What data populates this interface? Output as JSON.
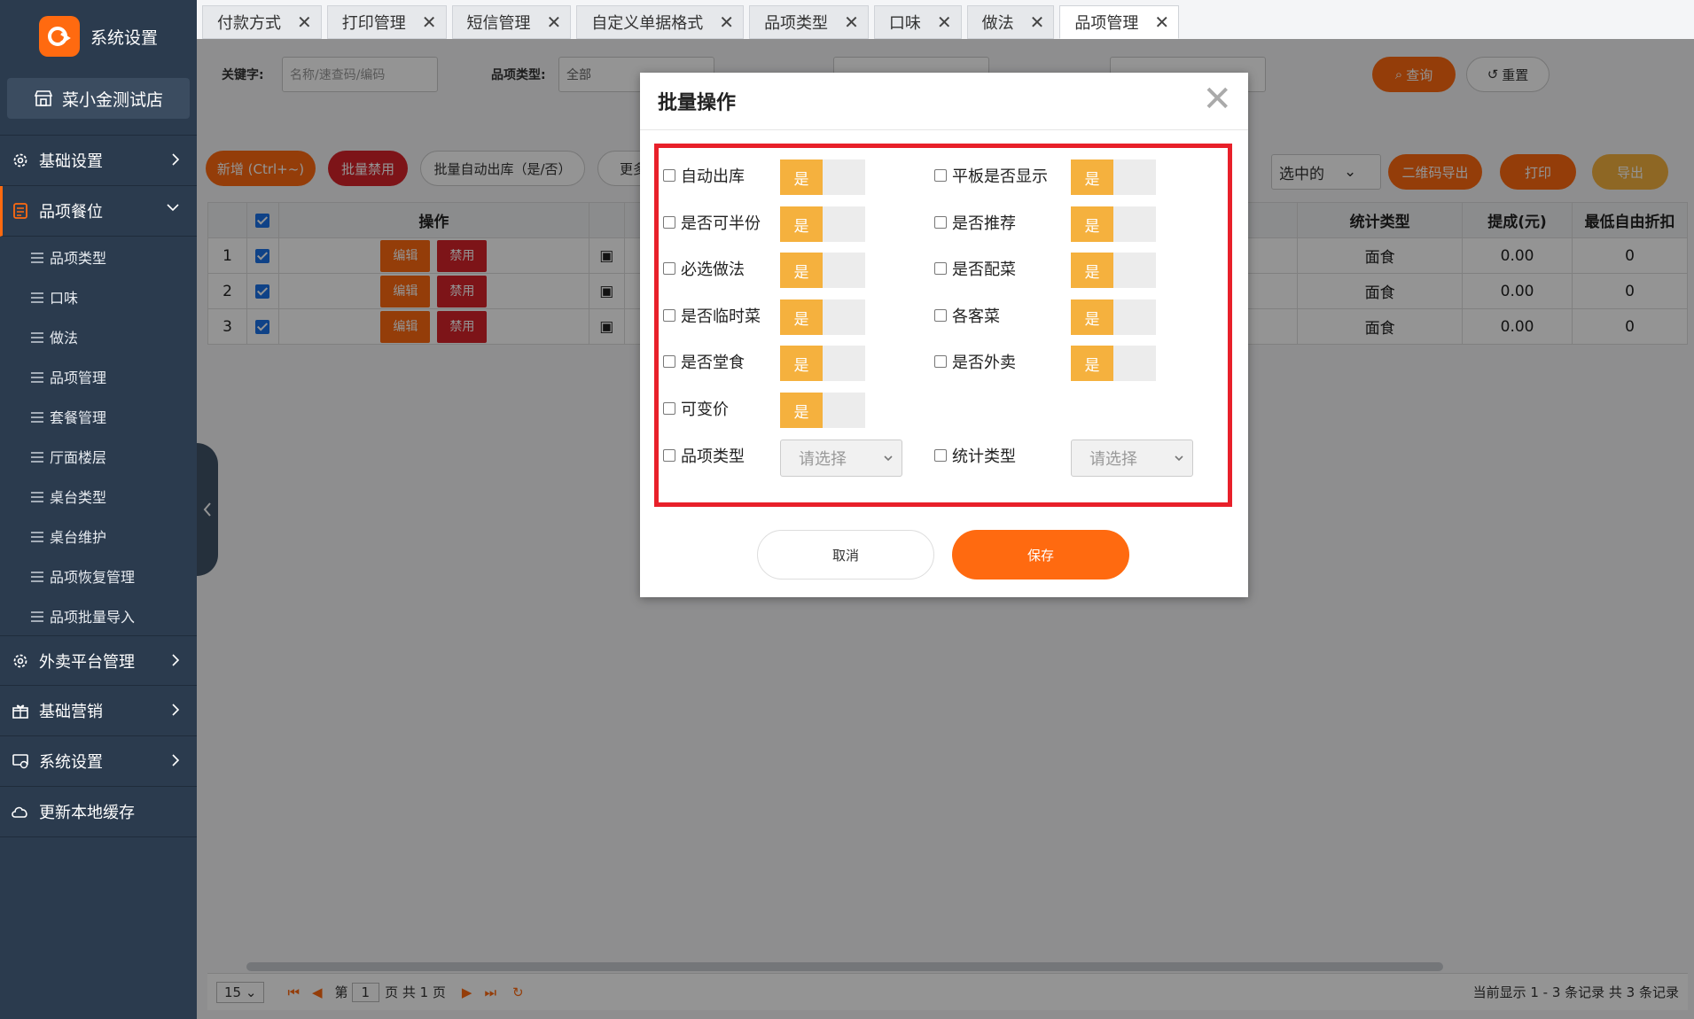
{
  "sidebar": {
    "brand": "系统设置",
    "store": "菜小金测试店",
    "nav": [
      {
        "label": "基础设置"
      },
      {
        "label": "品项餐位"
      },
      {
        "label": "外卖平台管理"
      },
      {
        "label": "基础营销"
      },
      {
        "label": "系统设置"
      },
      {
        "label": "更新本地缓存"
      }
    ],
    "submenu": [
      "品项类型",
      "口味",
      "做法",
      "品项管理",
      "套餐管理",
      "厅面楼层",
      "桌台类型",
      "桌台维护",
      "品项恢复管理",
      "品项批量导入"
    ]
  },
  "tabs": [
    "付款方式",
    "打印管理",
    "短信管理",
    "自定义单据格式",
    "品项类型",
    "口味",
    "做法",
    "品项管理"
  ],
  "filter": {
    "keyword_label": "关键字:",
    "keyword_placeholder": "名称/速查码/编码",
    "type_label": "品项类型:",
    "type_value": "全部",
    "query": "查询",
    "reset": "重置"
  },
  "actions": {
    "add": "新增 (Ctrl+~)",
    "batch_disable": "批量禁用",
    "batch_auto": "批量自动出库（是/否）",
    "more": "更多",
    "selected": "选中的",
    "qr_export": "二维码导出",
    "print": "打印",
    "export": "导出"
  },
  "table": {
    "headers": {
      "op": "操作",
      "stat": "统计类型",
      "commission": "提成(元)",
      "discount": "最低自由折扣"
    },
    "edit": "编辑",
    "disable": "禁用",
    "rows": [
      {
        "idx": "1",
        "stat": "面食",
        "commission": "0.00",
        "discount": "0"
      },
      {
        "idx": "2",
        "stat": "面食",
        "commission": "0.00",
        "discount": "0"
      },
      {
        "idx": "3",
        "stat": "面食",
        "commission": "0.00",
        "discount": "0"
      }
    ]
  },
  "pager": {
    "size": "15",
    "page_prefix": "第",
    "page": "1",
    "page_suffix": "页 共 1 页",
    "summary": "当前显示 1 - 3 条记录 共 3 条记录"
  },
  "modal": {
    "title": "批量操作",
    "yes": "是",
    "fields_left": [
      "自动出库",
      "是否可半份",
      "必选做法",
      "是否临时菜",
      "是否堂食",
      "可变价"
    ],
    "fields_right": [
      "平板是否显示",
      "是否推荐",
      "是否配菜",
      "各客菜",
      "是否外卖"
    ],
    "select_left_label": "品项类型",
    "select_right_label": "统计类型",
    "select_placeholder": "请选择",
    "cancel": "取消",
    "save": "保存"
  },
  "colors": {
    "accent": "#ff6a10",
    "danger": "#d8242a",
    "toggle_on": "#f5b13e",
    "highlight_box": "#e8202a"
  }
}
